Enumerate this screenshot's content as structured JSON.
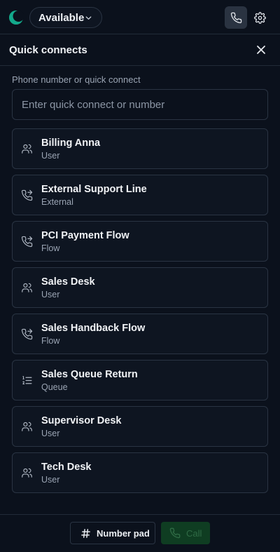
{
  "header": {
    "status_label": "Available",
    "logo_icon": "app-logo",
    "status_chevron_icon": "chevron-down-icon",
    "phone_icon": "phone-icon",
    "settings_icon": "gear-icon"
  },
  "panel": {
    "title": "Quick connects",
    "close_icon": "close-icon"
  },
  "search": {
    "label": "Phone number or quick connect",
    "placeholder": "Enter quick connect or number",
    "value": ""
  },
  "quick_connects": [
    {
      "name": "Billing Anna",
      "type": "User",
      "icon": "users-icon"
    },
    {
      "name": "External Support Line",
      "type": "External",
      "icon": "phone-forward-icon"
    },
    {
      "name": "PCI Payment Flow",
      "type": "Flow",
      "icon": "phone-forward-icon"
    },
    {
      "name": "Sales Desk",
      "type": "User",
      "icon": "users-icon"
    },
    {
      "name": "Sales Handback Flow",
      "type": "Flow",
      "icon": "phone-forward-icon"
    },
    {
      "name": "Sales Queue Return",
      "type": "Queue",
      "icon": "list-ordered-icon"
    },
    {
      "name": "Supervisor Desk",
      "type": "User",
      "icon": "users-icon"
    },
    {
      "name": "Tech Desk",
      "type": "User",
      "icon": "users-icon"
    }
  ],
  "footer": {
    "number_pad_label": "Number pad",
    "number_pad_icon": "hash-icon",
    "call_label": "Call",
    "call_icon": "phone-icon",
    "call_enabled": false
  },
  "colors": {
    "background": "#0b111c",
    "card": "#0e1521",
    "border": "#2a3443",
    "call_button_disabled": "#0f3d22",
    "logo_blue": "#3b82f6",
    "logo_green": "#22c55e"
  }
}
